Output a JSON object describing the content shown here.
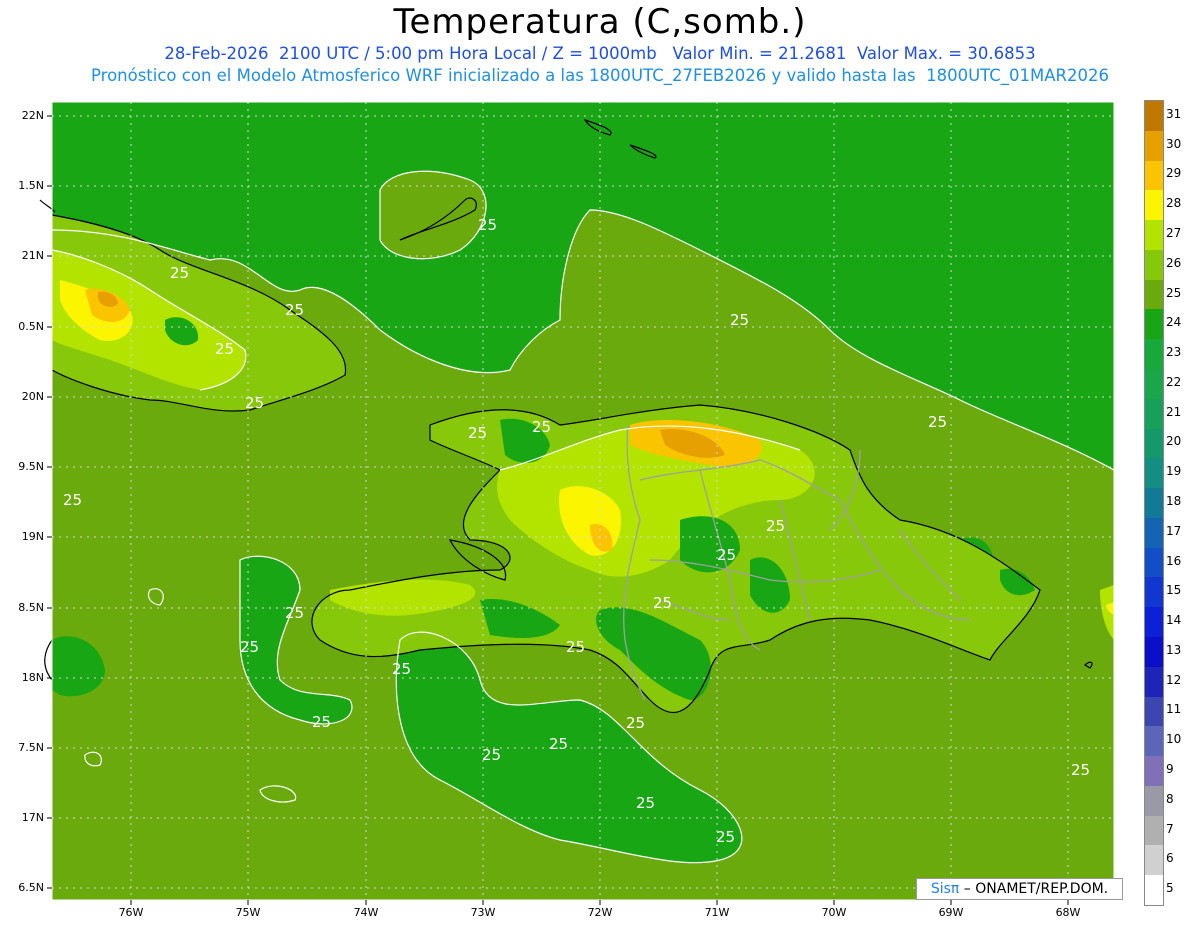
{
  "header": {
    "title": "Temperatura (C,somb.)",
    "line1": "28-Feb-2026  2100 UTC / 5:00 pm Hora Local / Z = 1000mb   Valor Min. = 21.2681  Valor Max. = 30.6853",
    "line2": "Pronóstico con el Modelo Atmosferico WRF inicializado a las 1800UTC_27FEB2026 y valido hasta las  1800UTC_01MAR2026"
  },
  "map": {
    "lat_labels": [
      "22N",
      "1.5N",
      "21N",
      "0.5N",
      "20N",
      "9.5N",
      "19N",
      "8.5N",
      "18N",
      "7.5N",
      "17N",
      "6.5N"
    ],
    "lon_labels": [
      "76W",
      "75W",
      "74W",
      "73W",
      "72W",
      "71W",
      "70W",
      "69W",
      "68W"
    ],
    "contour_label": "25",
    "colors": {
      "ocean": "#6aaa0c",
      "c24": "#18a614",
      "c26": "#87c80a",
      "c27": "#b2e400",
      "c28": "#fcf500",
      "c29": "#fbc400",
      "c30": "#e6a000",
      "border": "#000000",
      "provinces": "#a0a0a0"
    }
  },
  "colorbar": {
    "labels": [
      "31",
      "30",
      "29",
      "28",
      "27",
      "26",
      "25",
      "24",
      "23",
      "22",
      "21",
      "20",
      "19",
      "18",
      "17",
      "16",
      "15",
      "14",
      "13",
      "12",
      "11",
      "10",
      "9",
      "8",
      "7",
      "6",
      "5"
    ],
    "colors": [
      "#c07800",
      "#e6a000",
      "#fbc400",
      "#fcf500",
      "#b2e400",
      "#87c80a",
      "#6aaa0c",
      "#18a614",
      "#17a93a",
      "#1aa64a",
      "#16a05a",
      "#13996a",
      "#128e82",
      "#127a96",
      "#1364b2",
      "#124fc6",
      "#1037d0",
      "#0c20d8",
      "#0a10c8",
      "#1e24b8",
      "#3d45b0",
      "#5c66b8",
      "#8070b8",
      "#9a9aa6",
      "#b0b0b0",
      "#d0d0d0",
      "#ffffff"
    ]
  },
  "credit": {
    "sis": "Sisπ",
    "rest": " – ONAMET/REP.DOM."
  }
}
